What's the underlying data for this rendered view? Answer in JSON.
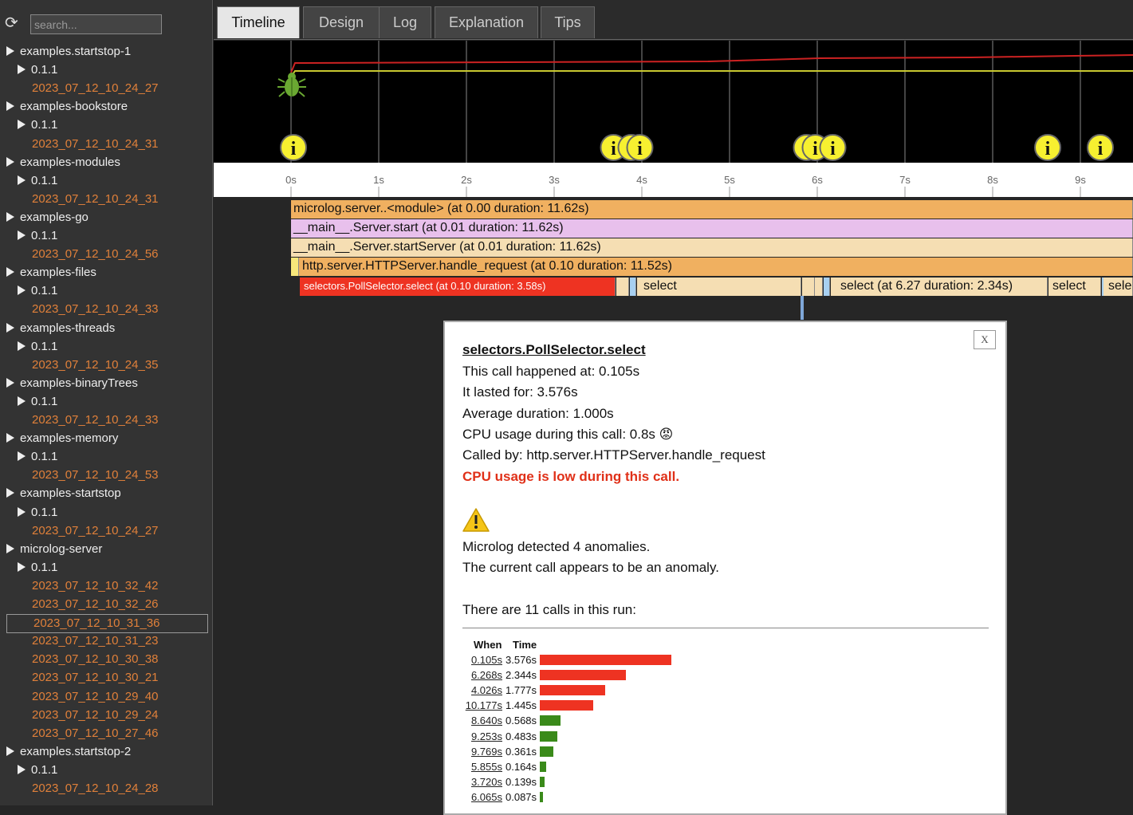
{
  "sidebar": {
    "search_placeholder": "search...",
    "tree": [
      {
        "kind": "app",
        "label": "examples.startstop-1"
      },
      {
        "kind": "ver",
        "label": "0.1.1"
      },
      {
        "kind": "run",
        "label": "2023_07_12_10_24_27"
      },
      {
        "kind": "app",
        "label": "examples-bookstore"
      },
      {
        "kind": "ver",
        "label": "0.1.1"
      },
      {
        "kind": "run",
        "label": "2023_07_12_10_24_31"
      },
      {
        "kind": "app",
        "label": "examples-modules"
      },
      {
        "kind": "ver",
        "label": "0.1.1"
      },
      {
        "kind": "run",
        "label": "2023_07_12_10_24_31"
      },
      {
        "kind": "app",
        "label": "examples-go"
      },
      {
        "kind": "ver",
        "label": "0.1.1"
      },
      {
        "kind": "run",
        "label": "2023_07_12_10_24_56"
      },
      {
        "kind": "app",
        "label": "examples-files"
      },
      {
        "kind": "ver",
        "label": "0.1.1"
      },
      {
        "kind": "run",
        "label": "2023_07_12_10_24_33"
      },
      {
        "kind": "app",
        "label": "examples-threads"
      },
      {
        "kind": "ver",
        "label": "0.1.1"
      },
      {
        "kind": "run",
        "label": "2023_07_12_10_24_35"
      },
      {
        "kind": "app",
        "label": "examples-binaryTrees"
      },
      {
        "kind": "ver",
        "label": "0.1.1"
      },
      {
        "kind": "run",
        "label": "2023_07_12_10_24_33"
      },
      {
        "kind": "app",
        "label": "examples-memory"
      },
      {
        "kind": "ver",
        "label": "0.1.1"
      },
      {
        "kind": "run",
        "label": "2023_07_12_10_24_53"
      },
      {
        "kind": "app",
        "label": "examples-startstop"
      },
      {
        "kind": "ver",
        "label": "0.1.1"
      },
      {
        "kind": "run",
        "label": "2023_07_12_10_24_27"
      },
      {
        "kind": "app",
        "label": "microlog-server"
      },
      {
        "kind": "ver",
        "label": "0.1.1"
      },
      {
        "kind": "run",
        "label": "2023_07_12_10_32_42"
      },
      {
        "kind": "run",
        "label": "2023_07_12_10_32_26"
      },
      {
        "kind": "run",
        "label": "2023_07_12_10_31_36",
        "selected": true
      },
      {
        "kind": "run",
        "label": "2023_07_12_10_31_23"
      },
      {
        "kind": "run",
        "label": "2023_07_12_10_30_38"
      },
      {
        "kind": "run",
        "label": "2023_07_12_10_30_21"
      },
      {
        "kind": "run",
        "label": "2023_07_12_10_29_40"
      },
      {
        "kind": "run",
        "label": "2023_07_12_10_29_24"
      },
      {
        "kind": "run",
        "label": "2023_07_12_10_27_46"
      },
      {
        "kind": "app",
        "label": "examples.startstop-2"
      },
      {
        "kind": "ver",
        "label": "0.1.1"
      },
      {
        "kind": "run",
        "label": "2023_07_12_10_24_28"
      }
    ]
  },
  "tabs": [
    {
      "label": "Timeline",
      "active": true
    },
    {
      "label": "Design"
    },
    {
      "label": "Log"
    },
    {
      "label": "Explanation"
    },
    {
      "label": "Tips"
    }
  ],
  "timeline": {
    "ticks": [
      "0s",
      "1s",
      "2s",
      "3s",
      "4s",
      "5s",
      "6s",
      "7s",
      "8s",
      "9s"
    ],
    "info_markers_at_s": [
      0.0,
      3.65,
      3.85,
      3.95,
      5.85,
      5.95,
      6.15,
      8.6,
      9.2
    ],
    "cpu_line_color": "#cc2222",
    "memory_line_color": "#c8c830",
    "flames": [
      {
        "label": "microlog.server..<module> (at 0.00 duration: 11.62s)",
        "color": "#f0b060"
      },
      {
        "label": "__main__.Server.start (at 0.01 duration: 11.62s)",
        "color": "#e8c0ec"
      },
      {
        "label": "__main__.Server.startServer (at 0.01 duration: 11.62s)",
        "color": "#f5deb3"
      },
      {
        "label": "http.server.HTTPServer.handle_request (at 0.10 duration: 11.52s)",
        "color": "#f0b060"
      }
    ],
    "select_row": [
      {
        "label": "selectors.PollSelector.select (at 0.10 duration: 3.58s)",
        "color": "#ee3322"
      },
      {
        "label": "select",
        "color": "#f5deb3"
      },
      {
        "label": "select (at 6.27 duration: 2.34s)",
        "color": "#f5deb3"
      },
      {
        "label": "select",
        "color": "#f5deb3"
      },
      {
        "label": "selec",
        "color": "#f5deb3"
      }
    ]
  },
  "popup": {
    "close_label": "X",
    "title": "selectors.PollSelector.select",
    "happened": "This call happened at: 0.105s",
    "lasted": "It lasted for: 3.576s",
    "average": "Average duration: 1.000s",
    "cpu": "CPU usage during this call: 0.8s",
    "cpu_emoji": "😡",
    "called_by": "Called by: http.server.HTTPServer.handle_request",
    "warning": "CPU usage is low during this call.",
    "warning_icon": "⚠️",
    "anomalies": "Microlog detected 4 anomalies.",
    "anomaly_current": "The current call appears to be an anomaly.",
    "calls_summary": "There are 11 calls in this run:",
    "col_when": "When",
    "col_time": "Time",
    "calls": [
      {
        "when": "0.105s",
        "time": "3.576s",
        "seconds": 3.576,
        "anomaly": true
      },
      {
        "when": "6.268s",
        "time": "2.344s",
        "seconds": 2.344,
        "anomaly": true
      },
      {
        "when": "4.026s",
        "time": "1.777s",
        "seconds": 1.777,
        "anomaly": true
      },
      {
        "when": "10.177s",
        "time": "1.445s",
        "seconds": 1.445,
        "anomaly": true
      },
      {
        "when": "8.640s",
        "time": "0.568s",
        "seconds": 0.568,
        "anomaly": false
      },
      {
        "when": "9.253s",
        "time": "0.483s",
        "seconds": 0.483,
        "anomaly": false
      },
      {
        "when": "9.769s",
        "time": "0.361s",
        "seconds": 0.361,
        "anomaly": false
      },
      {
        "when": "5.855s",
        "time": "0.164s",
        "seconds": 0.164,
        "anomaly": false
      },
      {
        "when": "3.720s",
        "time": "0.139s",
        "seconds": 0.139,
        "anomaly": false
      },
      {
        "when": "6.065s",
        "time": "0.087s",
        "seconds": 0.087,
        "anomaly": false
      }
    ],
    "anomaly_color": "#ee3322",
    "normal_color": "#3a8a1a"
  }
}
